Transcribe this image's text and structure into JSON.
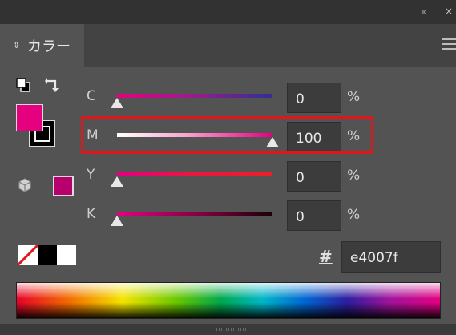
{
  "panel": {
    "title": "カラー",
    "collapse_glyph": "«",
    "close_glyph": "×",
    "menu_icon": "hamburger-menu-icon"
  },
  "colors": {
    "fill": "#e4007f",
    "stroke": "#000000",
    "gamut_swatch": "#b7006e",
    "highlight": "#e0161b"
  },
  "sliders": [
    {
      "label": "C",
      "value": "0",
      "unit": "%",
      "fraction": 0.0
    },
    {
      "label": "M",
      "value": "100",
      "unit": "%",
      "fraction": 1.0
    },
    {
      "label": "Y",
      "value": "0",
      "unit": "%",
      "fraction": 0.0
    },
    {
      "label": "K",
      "value": "0",
      "unit": "%",
      "fraction": 0.0
    }
  ],
  "hex": {
    "symbol": "#",
    "value": "e4007f"
  },
  "swatches": [
    "none",
    "black",
    "white"
  ]
}
